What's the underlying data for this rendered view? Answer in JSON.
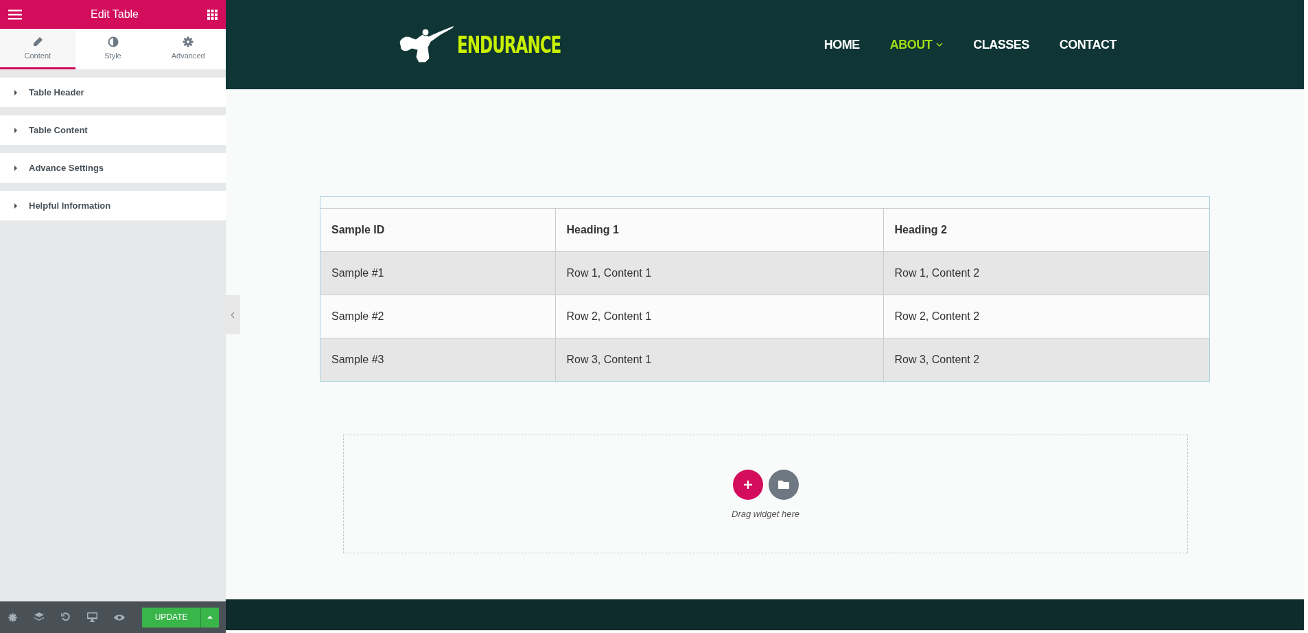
{
  "panel": {
    "title": "Edit Table",
    "tabs": [
      {
        "label": "Content",
        "selected": true
      },
      {
        "label": "Style",
        "selected": false
      },
      {
        "label": "Advanced",
        "selected": false
      }
    ],
    "sections": [
      {
        "label": "Table Header",
        "expanded": false
      },
      {
        "label": "Table Content",
        "expanded": false
      },
      {
        "label": "Advance Settings",
        "expanded": false
      },
      {
        "label": "Helpful Information",
        "expanded": false
      }
    ],
    "update_label": "UPDATE"
  },
  "site": {
    "logo_text": "ENDURANCE",
    "nav": [
      {
        "label": "HOME",
        "selected": false,
        "has_dropdown": false
      },
      {
        "label": "ABOUT",
        "selected": true,
        "has_dropdown": true
      },
      {
        "label": "CLASSES",
        "selected": false,
        "has_dropdown": false
      },
      {
        "label": "CONTACT",
        "selected": false,
        "has_dropdown": false
      }
    ]
  },
  "table": {
    "columns": [
      "Sample ID",
      "Heading 1",
      "Heading 2"
    ],
    "rows": [
      [
        "Sample #1",
        "Row 1, Content 1",
        "Row 1, Content 2"
      ],
      [
        "Sample #2",
        "Row 2, Content 1",
        "Row 2, Content 2"
      ],
      [
        "Sample #3",
        "Row 3, Content 1",
        "Row 3, Content 2"
      ]
    ]
  },
  "dropzone": {
    "hint": "Drag widget here"
  }
}
